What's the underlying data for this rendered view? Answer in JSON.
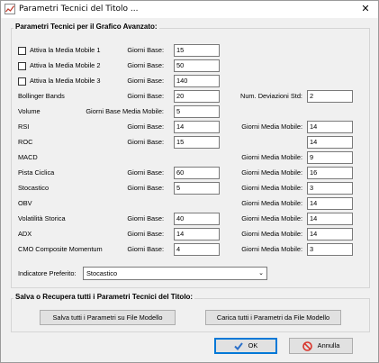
{
  "window": {
    "title": "Parametri Tecnici del Titolo ...",
    "close_glyph": "✕"
  },
  "group1": {
    "title": "Parametri Tecnici per il Grafico Avanzato:",
    "rows": [
      {
        "label": "Attiva la Media Mobile 1",
        "sub": "Giorni Base:",
        "val": "15"
      },
      {
        "label": "Attiva la Media Mobile 2",
        "sub": "Giorni Base:",
        "val": "50"
      },
      {
        "label": "Attiva la Media Mobile 3",
        "sub": "Giorni Base:",
        "val": "140"
      },
      {
        "label": "Bollinger Bands",
        "sub": "Giorni Base:",
        "val": "20",
        "sub2": "Num. Deviazioni Std:",
        "val2": "2"
      },
      {
        "label": "Volume",
        "sub": "Giorni Base Media Mobile:",
        "val": "5"
      },
      {
        "label": "RSI",
        "sub": "Giorni Base:",
        "val": "14",
        "sub2": "Giorni Media Mobile:",
        "val2": "14"
      },
      {
        "label": "ROC",
        "sub": "Giorni Base:",
        "val": "15",
        "val2": "14"
      },
      {
        "label": "MACD",
        "sub2": "Giorni Media Mobile:",
        "val2": "9"
      },
      {
        "label": "Pista Ciclica",
        "sub": "Giorni Base:",
        "val": "60",
        "sub2": "Giorni Media Mobile:",
        "val2": "16"
      },
      {
        "label": "Stocastico",
        "sub": "Giorni Base:",
        "val": "5",
        "sub2": "Giorni Media Mobile:",
        "val2": "3"
      },
      {
        "label": "OBV",
        "sub2": "Giorni Media Mobile:",
        "val2": "14"
      },
      {
        "label": "Volatilità Storica",
        "sub": "Giorni Base:",
        "val": "40",
        "sub2": "Giorni Media Mobile:",
        "val2": "14"
      },
      {
        "label": "ADX",
        "sub": "Giorni Base:",
        "val": "14",
        "sub2": "Giorni Media Mobile:",
        "val2": "14"
      },
      {
        "label": "CMO Composite Momentum",
        "sub": "Giorni Base:",
        "val": "4",
        "sub2": "Giorni Media Mobile:",
        "val2": "3"
      }
    ],
    "preferred_label": "Indicatore Preferito:",
    "preferred_value": "Stocastico"
  },
  "group2": {
    "title": "Salva o Recupera tutti i Parametri Tecnici del Titolo:",
    "save_label": "Salva tutti i Parametri su File Modello",
    "load_label": "Carica tutti i Parametri da File Modello"
  },
  "buttons": {
    "ok": "OK",
    "cancel": "Annulla"
  },
  "icons": {
    "ok": "check-icon",
    "cancel": "no-entry-icon"
  },
  "colors": {
    "ok_check": "#2a6fc9",
    "cancel_circle": "#d9342b",
    "default_border": "#0078d7"
  }
}
